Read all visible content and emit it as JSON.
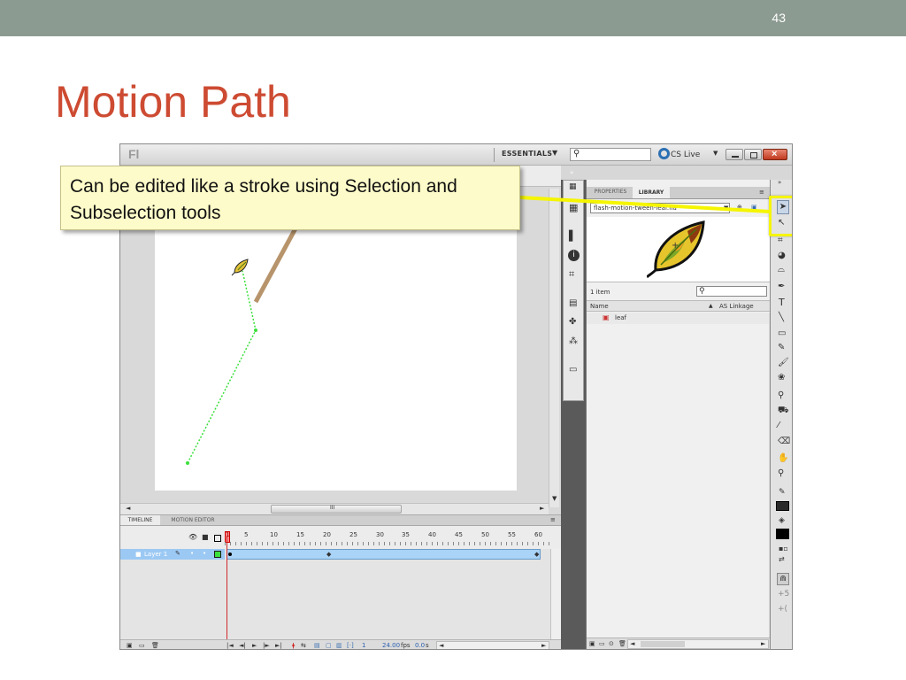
{
  "slide": {
    "number": "43",
    "title": "Motion Path"
  },
  "callout": {
    "text": "Can be edited like a stroke using Selection and Subselection tools"
  },
  "app": {
    "logo": "Fl",
    "workspace": "ESSENTIALS",
    "cs_live": "CS Live",
    "search_placeholder": ""
  },
  "timeline": {
    "tabs": [
      "TIMELINE",
      "MOTION EDITOR"
    ],
    "frame_numbers": [
      "1",
      "5",
      "10",
      "15",
      "20",
      "25",
      "30",
      "35",
      "40",
      "45",
      "50",
      "55",
      "60"
    ],
    "layer_name": "Layer 1",
    "current_frame": "1",
    "fps": "24.00",
    "fps_unit": "fps",
    "time": "0.0",
    "time_unit": "s"
  },
  "library": {
    "tabs": [
      "PROPERTIES",
      "LIBRARY"
    ],
    "document": "flash-motion-tween-leaf.fla",
    "item_count": "1 item",
    "col_name": "Name",
    "col_linkage": "AS Linkage",
    "items": [
      {
        "name": "leaf"
      }
    ]
  },
  "stage": {
    "hscroll_label": "III"
  },
  "colors": {
    "highlight": "#f5f500",
    "title": "#cd4b32",
    "path": "#3be03b"
  }
}
